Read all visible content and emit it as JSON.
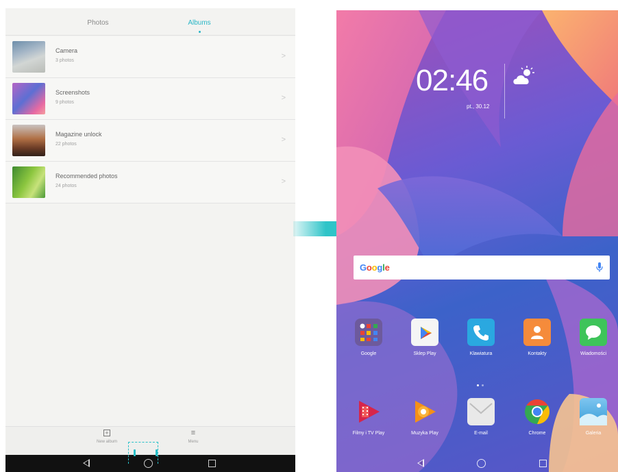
{
  "gallery": {
    "tabs": [
      {
        "label": "Photos",
        "active": false
      },
      {
        "label": "Albums",
        "active": true
      }
    ],
    "albums": [
      {
        "name": "Camera",
        "count": "3 photos"
      },
      {
        "name": "Screenshots",
        "count": "9 photos"
      },
      {
        "name": "Magazine unlock",
        "count": "22 photos"
      },
      {
        "name": "Recommended photos",
        "count": "24 photos"
      }
    ],
    "bottom_actions": [
      {
        "label": "New album",
        "icon": "add-box-icon"
      },
      {
        "label": "Menu",
        "icon": "menu-icon"
      }
    ],
    "accent_color": "#29b6c6"
  },
  "home": {
    "time": "02:46",
    "date": "pt., 30.12",
    "weather_icon": "partly-cloudy-icon",
    "search": {
      "logo": "Google",
      "mic_icon": "mic-icon"
    },
    "apps_row1": [
      {
        "label": "Google",
        "icon": "google-folder-icon"
      },
      {
        "label": "Sklep Play",
        "icon": "play-store-icon"
      },
      {
        "label": "Klawiatura",
        "icon": "phone-icon"
      },
      {
        "label": "Kontakty",
        "icon": "contacts-icon"
      },
      {
        "label": "Wiadomości",
        "icon": "messages-icon"
      }
    ],
    "apps_row2": [
      {
        "label": "Filmy i TV Play",
        "icon": "play-movies-icon"
      },
      {
        "label": "Muzyka Play",
        "icon": "play-music-icon"
      },
      {
        "label": "E-mail",
        "icon": "email-icon"
      },
      {
        "label": "Chrome",
        "icon": "chrome-icon"
      },
      {
        "label": "Galeria",
        "icon": "gallery-icon"
      }
    ]
  }
}
